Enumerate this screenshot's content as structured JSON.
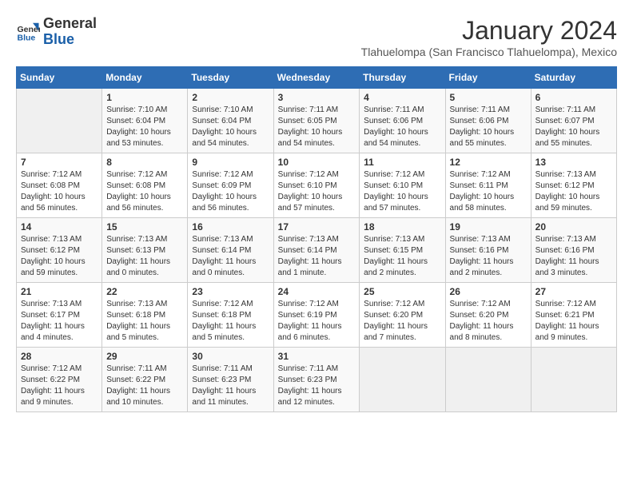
{
  "logo": {
    "text_general": "General",
    "text_blue": "Blue"
  },
  "calendar": {
    "title": "January 2024",
    "subtitle": "Tlahuelompa (San Francisco Tlahuelompa), Mexico"
  },
  "headers": [
    "Sunday",
    "Monday",
    "Tuesday",
    "Wednesday",
    "Thursday",
    "Friday",
    "Saturday"
  ],
  "weeks": [
    [
      {
        "day": "",
        "info": ""
      },
      {
        "day": "1",
        "info": "Sunrise: 7:10 AM\nSunset: 6:04 PM\nDaylight: 10 hours\nand 53 minutes."
      },
      {
        "day": "2",
        "info": "Sunrise: 7:10 AM\nSunset: 6:04 PM\nDaylight: 10 hours\nand 54 minutes."
      },
      {
        "day": "3",
        "info": "Sunrise: 7:11 AM\nSunset: 6:05 PM\nDaylight: 10 hours\nand 54 minutes."
      },
      {
        "day": "4",
        "info": "Sunrise: 7:11 AM\nSunset: 6:06 PM\nDaylight: 10 hours\nand 54 minutes."
      },
      {
        "day": "5",
        "info": "Sunrise: 7:11 AM\nSunset: 6:06 PM\nDaylight: 10 hours\nand 55 minutes."
      },
      {
        "day": "6",
        "info": "Sunrise: 7:11 AM\nSunset: 6:07 PM\nDaylight: 10 hours\nand 55 minutes."
      }
    ],
    [
      {
        "day": "7",
        "info": "Sunrise: 7:12 AM\nSunset: 6:08 PM\nDaylight: 10 hours\nand 56 minutes."
      },
      {
        "day": "8",
        "info": "Sunrise: 7:12 AM\nSunset: 6:08 PM\nDaylight: 10 hours\nand 56 minutes."
      },
      {
        "day": "9",
        "info": "Sunrise: 7:12 AM\nSunset: 6:09 PM\nDaylight: 10 hours\nand 56 minutes."
      },
      {
        "day": "10",
        "info": "Sunrise: 7:12 AM\nSunset: 6:10 PM\nDaylight: 10 hours\nand 57 minutes."
      },
      {
        "day": "11",
        "info": "Sunrise: 7:12 AM\nSunset: 6:10 PM\nDaylight: 10 hours\nand 57 minutes."
      },
      {
        "day": "12",
        "info": "Sunrise: 7:12 AM\nSunset: 6:11 PM\nDaylight: 10 hours\nand 58 minutes."
      },
      {
        "day": "13",
        "info": "Sunrise: 7:13 AM\nSunset: 6:12 PM\nDaylight: 10 hours\nand 59 minutes."
      }
    ],
    [
      {
        "day": "14",
        "info": "Sunrise: 7:13 AM\nSunset: 6:12 PM\nDaylight: 10 hours\nand 59 minutes."
      },
      {
        "day": "15",
        "info": "Sunrise: 7:13 AM\nSunset: 6:13 PM\nDaylight: 11 hours\nand 0 minutes."
      },
      {
        "day": "16",
        "info": "Sunrise: 7:13 AM\nSunset: 6:14 PM\nDaylight: 11 hours\nand 0 minutes."
      },
      {
        "day": "17",
        "info": "Sunrise: 7:13 AM\nSunset: 6:14 PM\nDaylight: 11 hours\nand 1 minute."
      },
      {
        "day": "18",
        "info": "Sunrise: 7:13 AM\nSunset: 6:15 PM\nDaylight: 11 hours\nand 2 minutes."
      },
      {
        "day": "19",
        "info": "Sunrise: 7:13 AM\nSunset: 6:16 PM\nDaylight: 11 hours\nand 2 minutes."
      },
      {
        "day": "20",
        "info": "Sunrise: 7:13 AM\nSunset: 6:16 PM\nDaylight: 11 hours\nand 3 minutes."
      }
    ],
    [
      {
        "day": "21",
        "info": "Sunrise: 7:13 AM\nSunset: 6:17 PM\nDaylight: 11 hours\nand 4 minutes."
      },
      {
        "day": "22",
        "info": "Sunrise: 7:13 AM\nSunset: 6:18 PM\nDaylight: 11 hours\nand 5 minutes."
      },
      {
        "day": "23",
        "info": "Sunrise: 7:12 AM\nSunset: 6:18 PM\nDaylight: 11 hours\nand 5 minutes."
      },
      {
        "day": "24",
        "info": "Sunrise: 7:12 AM\nSunset: 6:19 PM\nDaylight: 11 hours\nand 6 minutes."
      },
      {
        "day": "25",
        "info": "Sunrise: 7:12 AM\nSunset: 6:20 PM\nDaylight: 11 hours\nand 7 minutes."
      },
      {
        "day": "26",
        "info": "Sunrise: 7:12 AM\nSunset: 6:20 PM\nDaylight: 11 hours\nand 8 minutes."
      },
      {
        "day": "27",
        "info": "Sunrise: 7:12 AM\nSunset: 6:21 PM\nDaylight: 11 hours\nand 9 minutes."
      }
    ],
    [
      {
        "day": "28",
        "info": "Sunrise: 7:12 AM\nSunset: 6:22 PM\nDaylight: 11 hours\nand 9 minutes."
      },
      {
        "day": "29",
        "info": "Sunrise: 7:11 AM\nSunset: 6:22 PM\nDaylight: 11 hours\nand 10 minutes."
      },
      {
        "day": "30",
        "info": "Sunrise: 7:11 AM\nSunset: 6:23 PM\nDaylight: 11 hours\nand 11 minutes."
      },
      {
        "day": "31",
        "info": "Sunrise: 7:11 AM\nSunset: 6:23 PM\nDaylight: 11 hours\nand 12 minutes."
      },
      {
        "day": "",
        "info": ""
      },
      {
        "day": "",
        "info": ""
      },
      {
        "day": "",
        "info": ""
      }
    ]
  ]
}
